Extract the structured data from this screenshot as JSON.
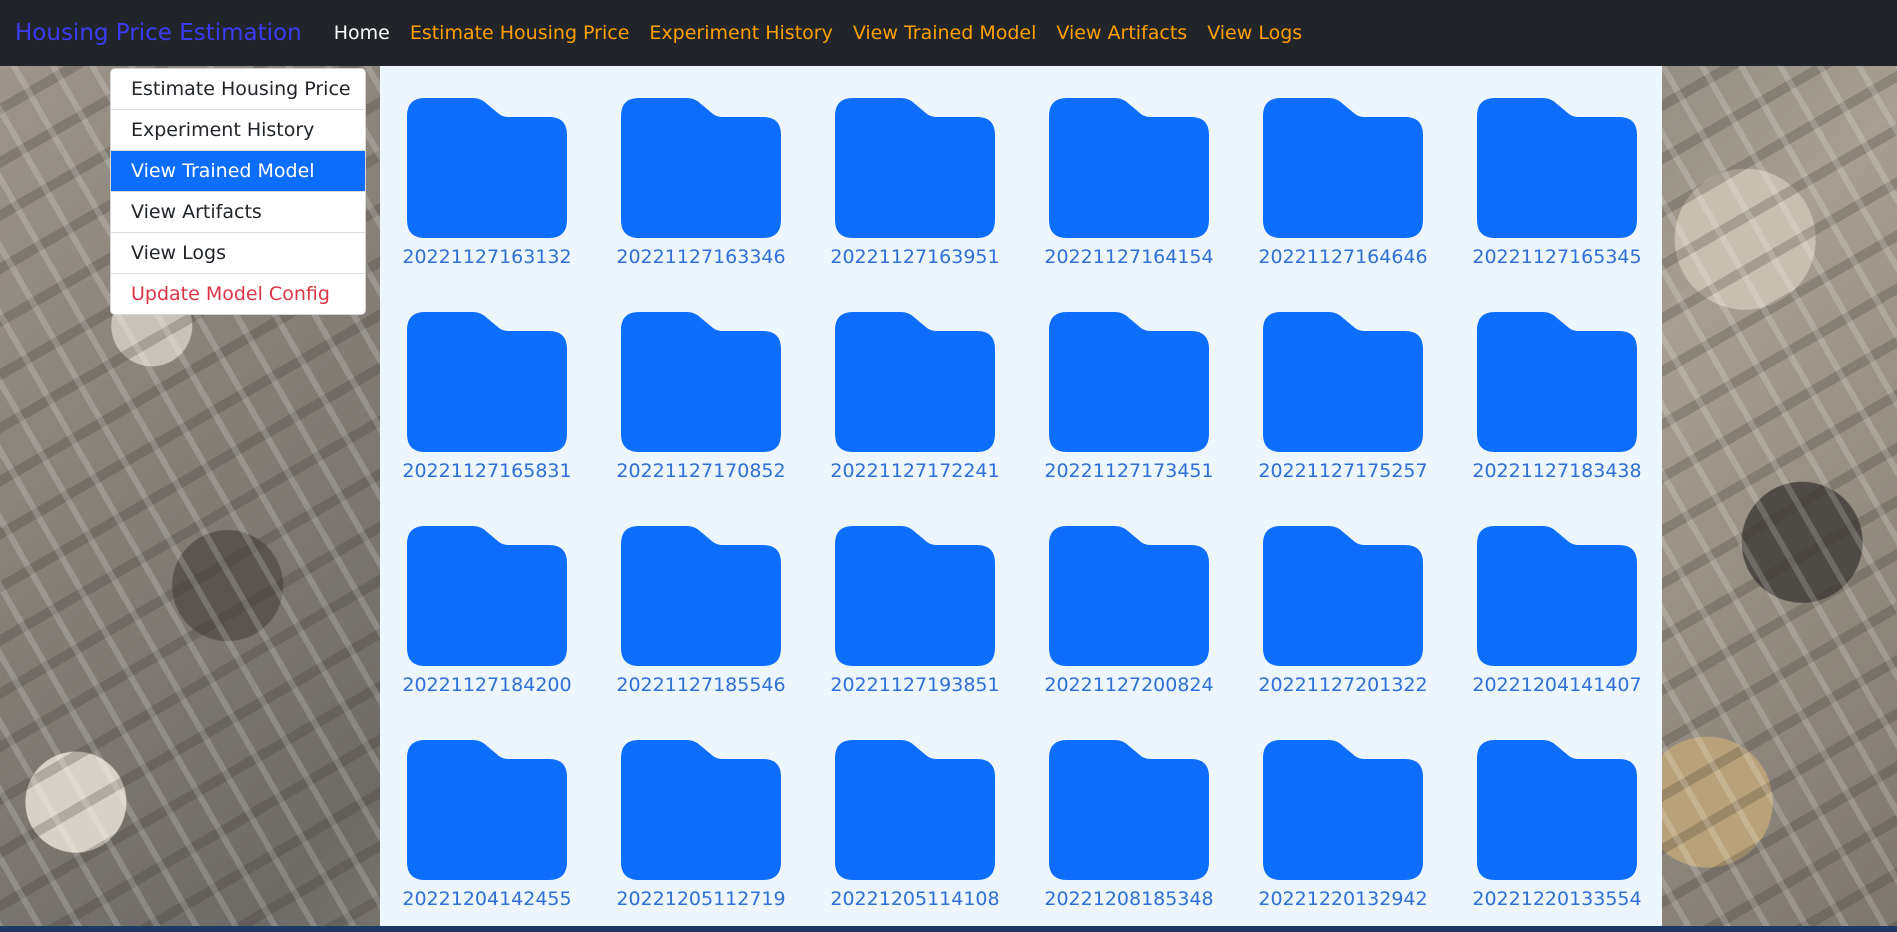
{
  "navbar": {
    "brand": "Housing Price Estimation",
    "links": [
      {
        "label": "Home"
      },
      {
        "label": "Estimate Housing Price"
      },
      {
        "label": "Experiment History"
      },
      {
        "label": "View Trained Model"
      },
      {
        "label": "View Artifacts"
      },
      {
        "label": "View Logs"
      }
    ]
  },
  "side_menu": {
    "items": [
      {
        "label": "Estimate Housing Price"
      },
      {
        "label": "Experiment History"
      },
      {
        "label": "View Trained Model",
        "active": true
      },
      {
        "label": "View Artifacts"
      },
      {
        "label": "View Logs"
      },
      {
        "label": "Update Model Config"
      }
    ]
  },
  "folders": [
    "20221127163132",
    "20221127163346",
    "20221127163951",
    "20221127164154",
    "20221127164646",
    "20221127165345",
    "20221127165831",
    "20221127170852",
    "20221127172241",
    "20221127173451",
    "20221127175257",
    "20221127183438",
    "20221127184200",
    "20221127185546",
    "20221127193851",
    "20221127200824",
    "20221127201322",
    "20221204141407",
    "20221204142455",
    "20221205112719",
    "20221205114108",
    "20221208185348",
    "20221220132942",
    "20221220133554"
  ],
  "colors": {
    "navbar_bg": "#212529",
    "brand": "#3b3bf5",
    "nav_link": "#ff9f00",
    "active": "#0d6efd",
    "danger": "#dc3545",
    "folder": "#0d6efd",
    "folder_label": "#2f6fd6",
    "content_bg": "#eef6fd"
  },
  "icons": {
    "folder": "folder-icon"
  }
}
